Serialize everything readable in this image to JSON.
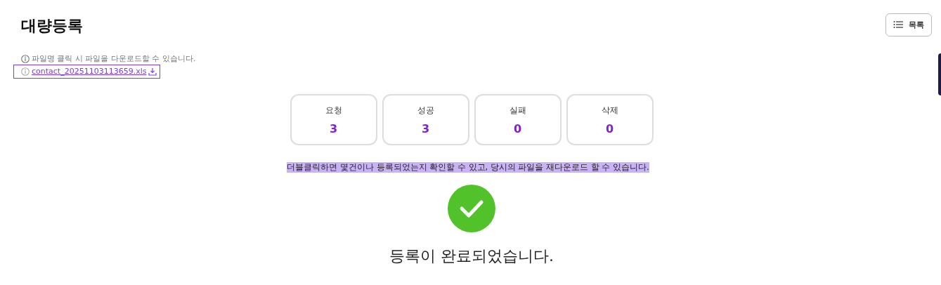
{
  "page": {
    "title": "대량등록",
    "list_button": "목록"
  },
  "hint": "파일명 클릭 시 파일을 다운로드할 수 있습니다.",
  "file_link": {
    "name": "contact_20251103113659.xls",
    "focused": true
  },
  "stats": [
    {
      "label": "요청",
      "value": "3"
    },
    {
      "label": "성공",
      "value": "3"
    },
    {
      "label": "실패",
      "value": "0"
    },
    {
      "label": "삭제",
      "value": "0"
    }
  ],
  "notice": {
    "text": "더블클릭하면 몇건이나 등록되었는지 확인할 수 있고,  당시의 파일을 재다운로드 할 수 있습니다.",
    "highlighted": true
  },
  "result": {
    "success": true,
    "message": "등록이 완료되었습니다."
  }
}
